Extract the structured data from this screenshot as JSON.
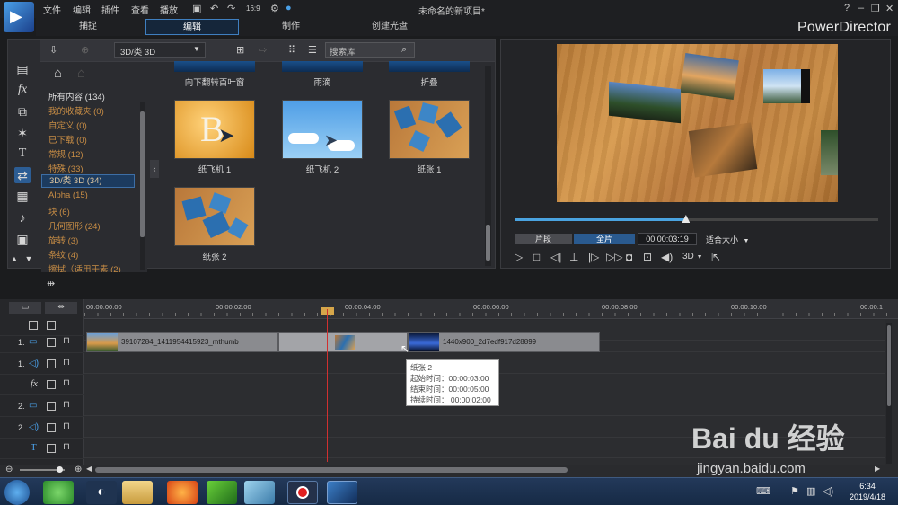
{
  "menu": {
    "items": [
      "文件",
      "编辑",
      "插件",
      "查看",
      "播放"
    ],
    "window_title": "未命名的新项目*",
    "brand": "PowerDirector"
  },
  "modes": [
    "捕捉",
    "编辑",
    "制作",
    "创建光盘"
  ],
  "library": {
    "dropdown_value": "3D/类 3D",
    "search_placeholder": "搜索库",
    "categories": [
      "所有内容 (134)",
      "我的收藏夹  (0)",
      "自定义  (0)",
      "已下载  (0)",
      "常规  (12)",
      "特殊  (33)",
      "3D/类 3D  (34)",
      "Alpha  (15)",
      "块  (6)",
      "几何图形  (24)",
      "旋转  (3)",
      "条纹  (4)",
      "擦拭（适用于素 (2)"
    ],
    "top_row_labels": [
      "向下翻转百叶窗",
      "雨滴",
      "折叠"
    ],
    "thumbnails": [
      "纸飞机 1",
      "纸飞机 2",
      "纸张 1",
      "纸张 2"
    ]
  },
  "preview": {
    "btn_clip": "片段",
    "btn_movie": "全片",
    "timecode": "00:00:03:19",
    "fit_label": "适合大小",
    "mode_3d": "3D",
    "seek_fraction": 0.47
  },
  "timeline": {
    "ruler": [
      "00:00:00:00",
      "00:00:02:00",
      "00:00:04:00",
      "00:00:06:00",
      "00:00:08:00",
      "00:00:10:00",
      "00:00:1"
    ],
    "tracks": [
      "1.",
      "1.",
      "",
      "2.",
      "2.",
      ""
    ],
    "clip1": "39107284_1411954415923_mthumb",
    "clip2": "1440x900_2d7edf917d28899",
    "tooltip": {
      "name": "纸张 2",
      "start": "起始时间：00:00:03:00",
      "end": "结束时间：00:00:05:00",
      "duration": "持续时间： 00:00:02:00"
    }
  },
  "taskbar": {
    "time": "6:34",
    "date": "2019/4/18"
  },
  "watermark": {
    "text": "Bai du 经验",
    "site": "jingyan.baidu.com"
  },
  "colors": {
    "accent": "#3f7fc0",
    "category_text": "#c88d45",
    "playhead": "#d03030"
  }
}
